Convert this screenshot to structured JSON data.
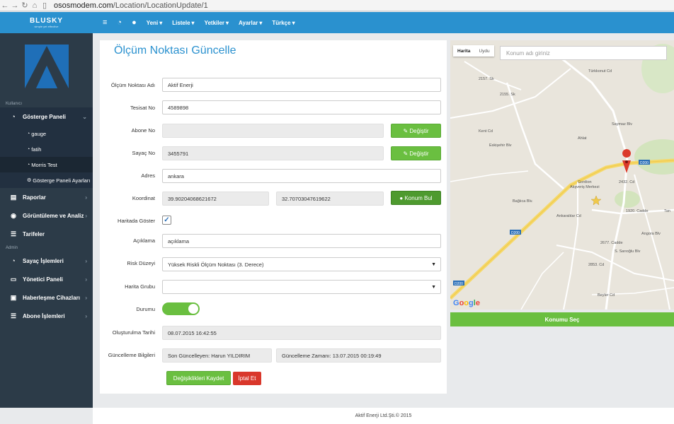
{
  "browser": {
    "url_host": "ososmodem.com",
    "url_path": "/Location/LocationUpdate/1"
  },
  "topnav": {
    "brand": "BLUSKY",
    "brand_tag": "simple yet effective",
    "items": [
      "Yeni",
      "Listele",
      "Yetkiler",
      "Ayarlar",
      "Türkçe"
    ]
  },
  "sidebar": {
    "section_user": "Kullanıcı",
    "dashboard": "Gösterge Paneli",
    "sub_items": [
      "gauge",
      "fatih",
      "Morris Test",
      "Gösterge Paneli Ayarları"
    ],
    "reports": "Raporlar",
    "view_analysis": "Görüntüleme ve Analiz",
    "tariffs": "Tarifeler",
    "section_admin": "Admin",
    "meter_ops": "Sayaç İşlemleri",
    "admin_panel": "Yönetici Paneli",
    "comm_devices": "Haberleşme Cihazları",
    "subscriber_ops": "Abone İşlemleri"
  },
  "form": {
    "title": "Ölçüm Noktası Güncelle",
    "labels": {
      "name": "Ölçüm Noktası Adı",
      "facility": "Tesisat No",
      "subscriber": "Abone No",
      "meter": "Sayaç No",
      "address": "Adres",
      "coord": "Koordinat",
      "show_map": "Haritada Göster",
      "desc": "Açıklama",
      "risk": "Risk Düzeyi",
      "map_group": "Harita Grubu",
      "status": "Durumu",
      "created": "Oluşturulma Tarihi",
      "update_info": "Güncelleme Bilgileri"
    },
    "values": {
      "name": "Aktif Enerji",
      "facility": "4589898",
      "subscriber": "",
      "meter": "3455791",
      "address": "ankara",
      "lat": "39.90204068621672",
      "lng": "32.70703047619622",
      "desc": "açıklama",
      "risk": "Yüksek Riskli Ölçüm Noktası (3. Derece)",
      "map_group": "",
      "created": "08.07.2015 16:42:55",
      "last_updater": "Son Güncelleyen: Harun YILDIRIM",
      "update_time": "Güncelleme Zamanı: 13.07.2015 00:19:49"
    },
    "show_map_checked": true,
    "status_on": true,
    "buttons": {
      "change": "Değiştir",
      "find_location": "Konum Bul",
      "save": "Değişiklikleri Kaydet",
      "cancel": "İptal Et"
    }
  },
  "map": {
    "tab_map": "Harita",
    "tab_satellite": "Uydu",
    "search_placeholder": "Konum adı giriniz",
    "select_button": "Konumu Seç",
    "google": "Google",
    "labels": [
      "Gordion",
      "Alışveriş Merkezi",
      "Bağlıca Blv.",
      "1920. Cadde",
      "D200",
      "2853. Cd",
      "Beyler Cd",
      "Türkkonut Cd",
      "2157. Sk",
      "2155. Sk",
      "Saymaz Blv",
      "2432. Cd",
      "Ankaralılar Cd",
      "2677. Cadde",
      "S. Sarıoğlu Blv",
      "Angora Blv",
      "Tan",
      "Kent Cd",
      "Eskişehir Blv",
      "Ahlat"
    ]
  },
  "footer": {
    "copyright": "Aktif Enerji Ltd.Şti.© 2015"
  }
}
